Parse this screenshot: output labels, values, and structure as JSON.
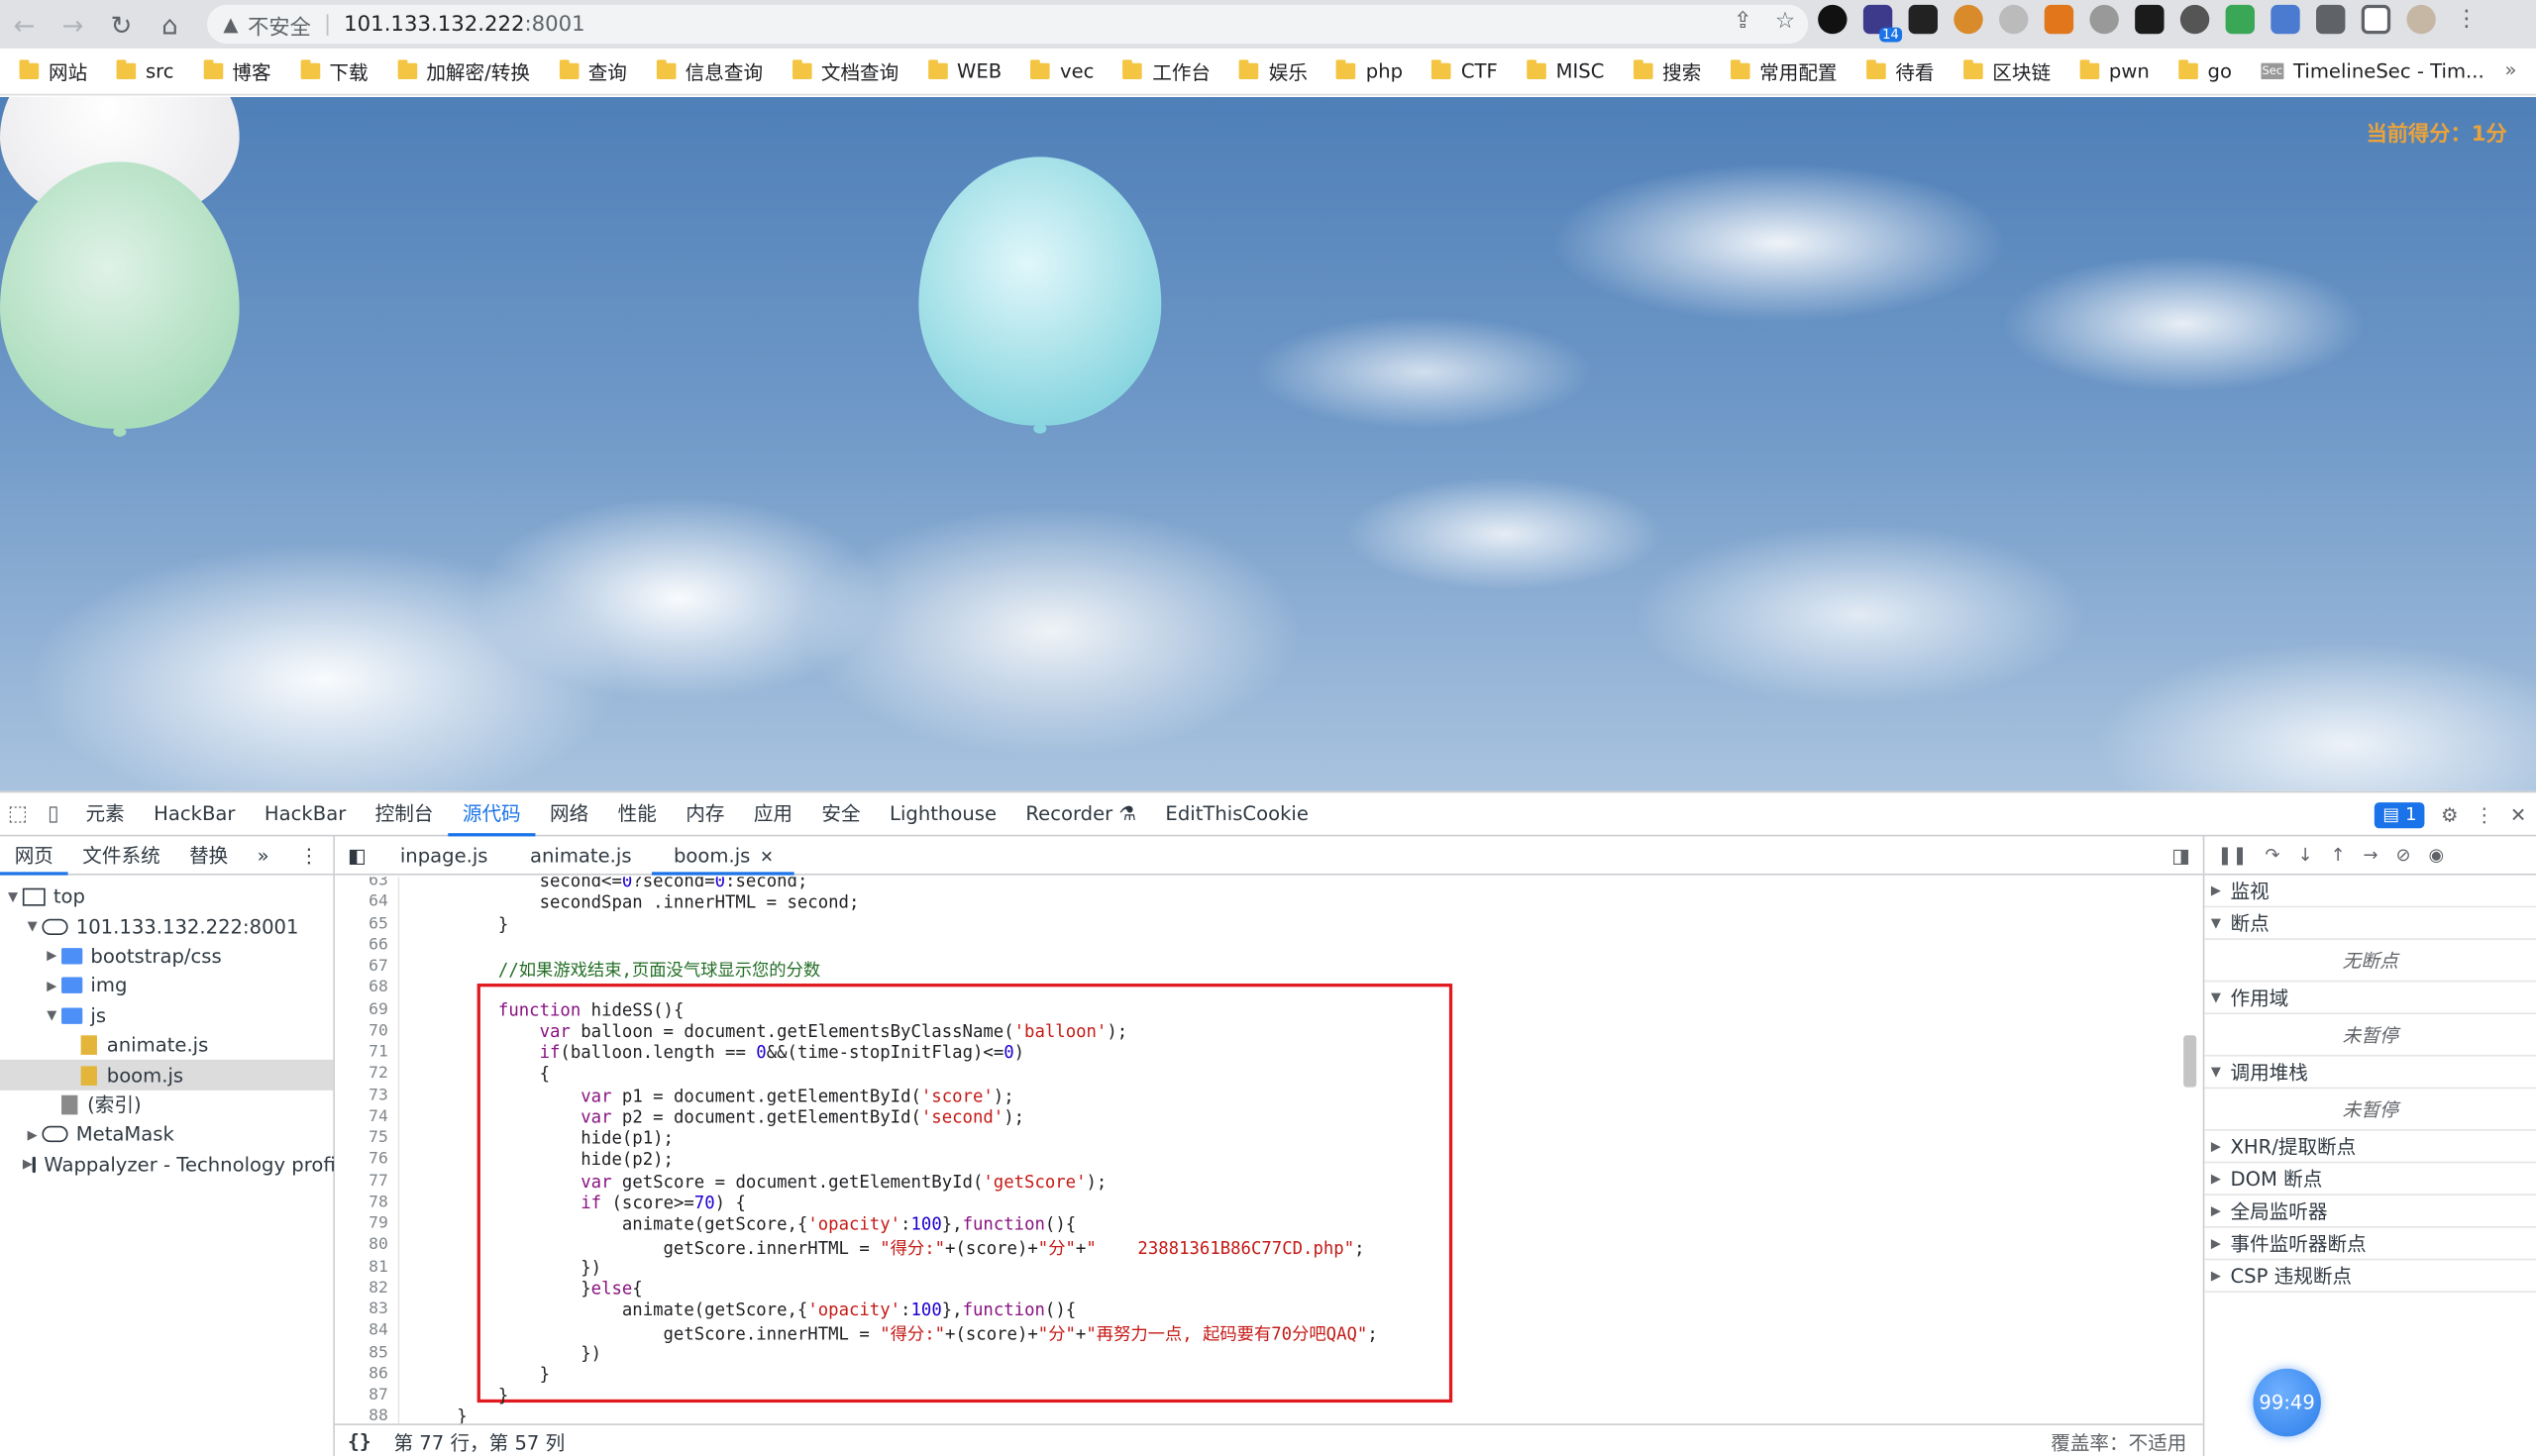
{
  "browser": {
    "address": {
      "warning": "不安全",
      "host": "101.133.132.222",
      "port": ":8001"
    },
    "bookmarks": [
      "网站",
      "src",
      "博客",
      "下载",
      "加解密/转换",
      "查询",
      "信息查询",
      "文档查询",
      "WEB",
      "vec",
      "工作台",
      "娱乐",
      "php",
      "CTF",
      "MISC",
      "搜索",
      "常用配置",
      "待看",
      "区块链",
      "pwn",
      "go"
    ],
    "bookmark_site": "TimelineSec - Tim...",
    "bookmarks_more": "»",
    "extension_badge": "14"
  },
  "page": {
    "score_label": "当前得分：1分"
  },
  "devtools": {
    "tabs": [
      "元素",
      "HackBar",
      "HackBar",
      "控制台",
      "源代码",
      "网络",
      "性能",
      "内存",
      "应用",
      "安全",
      "Lighthouse",
      "Recorder",
      "EditThisCookie"
    ],
    "active_tab": "源代码",
    "messages_count": "1",
    "left_subtabs": [
      "网页",
      "文件系统",
      "替换"
    ],
    "tree": [
      {
        "label": "top"
      },
      {
        "label": "101.133.132.222:8001"
      },
      {
        "label": "bootstrap/css"
      },
      {
        "label": "img"
      },
      {
        "label": "js"
      },
      {
        "label": "animate.js"
      },
      {
        "label": "boom.js"
      },
      {
        "label": "(索引)"
      },
      {
        "label": "MetaMask"
      },
      {
        "label": "Wappalyzer - Technology profiler"
      }
    ],
    "file_tabs": [
      "inpage.js",
      "animate.js",
      "boom.js"
    ],
    "status_position": "第 77 行，第 57 列",
    "coverage": "覆盖率：不适用",
    "right": {
      "watch": "监视",
      "breakpoints": "断点",
      "no_breakpoints": "无断点",
      "scope": "作用域",
      "not_paused_1": "未暂停",
      "call_stack": "调用堆栈",
      "not_paused_2": "未暂停",
      "xhr": "XHR/提取断点",
      "dom": "DOM 断点",
      "global": "全局监听器",
      "event": "事件监听器断点",
      "csp": "CSP 违规断点"
    }
  },
  "code_lines": [
    {
      "n": "63",
      "t": "            second<=0?second=0:second;"
    },
    {
      "n": "64",
      "t": "            secondSpan .innerHTML = second;"
    },
    {
      "n": "65",
      "t": "        }"
    },
    {
      "n": "66",
      "t": ""
    },
    {
      "n": "67",
      "t": "        //如果游戏结束,页面没气球显示您的分数"
    },
    {
      "n": "68",
      "t": ""
    },
    {
      "n": "69",
      "t": "        function hideSS(){"
    },
    {
      "n": "70",
      "t": "            var balloon = document.getElementsByClassName('balloon');"
    },
    {
      "n": "71",
      "t": "            if(balloon.length == 0&&(time-stopInitFlag)<=0)"
    },
    {
      "n": "72",
      "t": "            {"
    },
    {
      "n": "73",
      "t": "                var p1 = document.getElementById('score');"
    },
    {
      "n": "74",
      "t": "                var p2 = document.getElementById('second');"
    },
    {
      "n": "75",
      "t": "                hide(p1);"
    },
    {
      "n": "76",
      "t": "                hide(p2);"
    },
    {
      "n": "77",
      "t": "                var getScore = document.getElementById('getScore');"
    },
    {
      "n": "78",
      "t": "                if (score>=70) {"
    },
    {
      "n": "79",
      "t": "                    animate(getScore,{'opacity':100},function(){"
    },
    {
      "n": "80",
      "t": "                        getScore.innerHTML = \"得分:\"+(score)+\"分\"+\"    23881361B86C77CD.php\";"
    },
    {
      "n": "81",
      "t": "                })"
    },
    {
      "n": "82",
      "t": "                }else{"
    },
    {
      "n": "83",
      "t": "                    animate(getScore,{'opacity':100},function(){"
    },
    {
      "n": "84",
      "t": "                        getScore.innerHTML = \"得分:\"+(score)+\"分\"+\"再努力一点, 起码要有70分吧QAQ\";"
    },
    {
      "n": "85",
      "t": "                })"
    },
    {
      "n": "86",
      "t": "            }"
    },
    {
      "n": "87",
      "t": "        }"
    },
    {
      "n": "88",
      "t": "    }"
    }
  ],
  "timer": "99:49",
  "colors": {
    "accent": "#1a73e8",
    "highlight_border": "#e0191e",
    "score_orange": "#e8a33d"
  }
}
